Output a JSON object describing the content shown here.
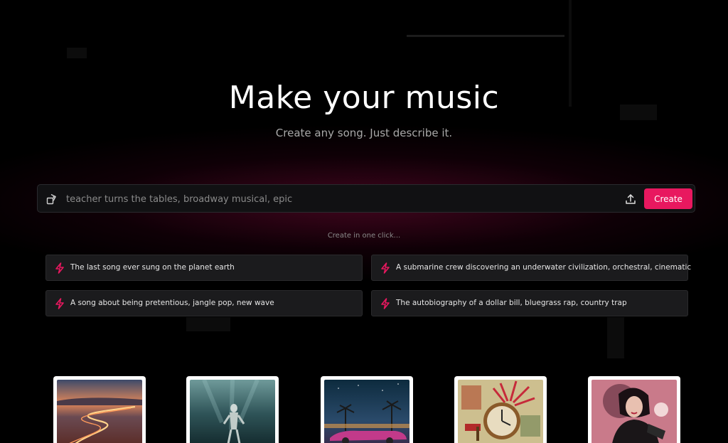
{
  "hero": {
    "title": "Make your music",
    "subtitle": "Create any song. Just describe it."
  },
  "prompt": {
    "placeholder": "teacher turns the tables, broadway musical, epic",
    "create_label": "Create",
    "mode_icon": "shapes-icon",
    "upload_icon": "upload-icon"
  },
  "quick": {
    "label": "Create in one click...",
    "suggestions": [
      "The last song ever sung on the planet earth",
      "A submarine crew discovering an underwater civilization, orchestral, cinematic",
      "A song about being pretentious, jangle pop, new wave",
      "The autobiography of a dollar bill, bluegrass rap, country trap"
    ]
  },
  "colors": {
    "accent": "#e8185f",
    "background": "#000000",
    "card": "#1b1b1d"
  }
}
